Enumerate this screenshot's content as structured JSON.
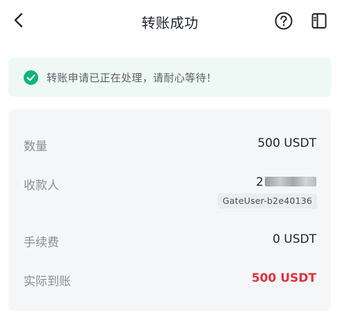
{
  "header": {
    "title": "转账成功",
    "back_icon": "chevron-left-icon",
    "help_icon": "help-circle-icon",
    "panel_icon": "side-panel-icon"
  },
  "notice": {
    "message": "转账申请已正在处理，请耐心等待！",
    "icon": "check-circle-icon",
    "color": "#0fb476"
  },
  "details": {
    "amount_label": "数量",
    "amount_value": "500 USDT",
    "recipient_label": "收款人",
    "recipient_id_visible": "2",
    "recipient_tag": "GateUser-b2e40136",
    "fee_label": "手续费",
    "fee_value": "0 USDT",
    "received_label": "实际到账",
    "received_value": "500 USDT",
    "received_color": "#e0313b"
  }
}
